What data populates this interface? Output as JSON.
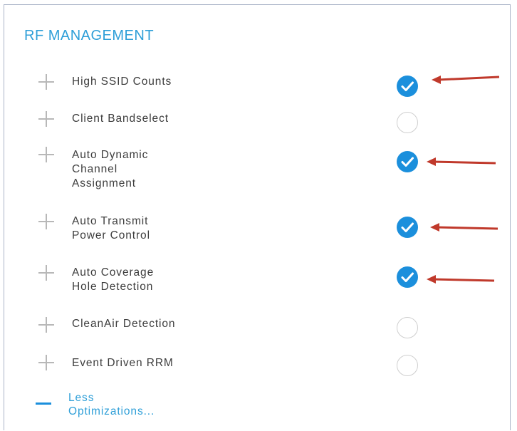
{
  "section": {
    "title": "RF MANAGEMENT"
  },
  "options": [
    {
      "label": "High SSID Counts",
      "checked": true,
      "annotated": true
    },
    {
      "label": "Client Bandselect",
      "checked": false,
      "annotated": false
    },
    {
      "label": "Auto Dynamic\nChannel\nAssignment",
      "checked": true,
      "annotated": true
    },
    {
      "label": "Auto Transmit\nPower Control",
      "checked": true,
      "annotated": true
    },
    {
      "label": "Auto Coverage\nHole Detection",
      "checked": true,
      "annotated": true
    },
    {
      "label": "CleanAir Detection",
      "checked": false,
      "annotated": false
    },
    {
      "label": "Event Driven RRM",
      "checked": false,
      "annotated": false
    }
  ],
  "footer": {
    "less_link": "Less\nOptimizations..."
  },
  "colors": {
    "accent": "#1b8fdc",
    "title": "#2f9fd8",
    "annotation_arrow": "#c0392b"
  }
}
